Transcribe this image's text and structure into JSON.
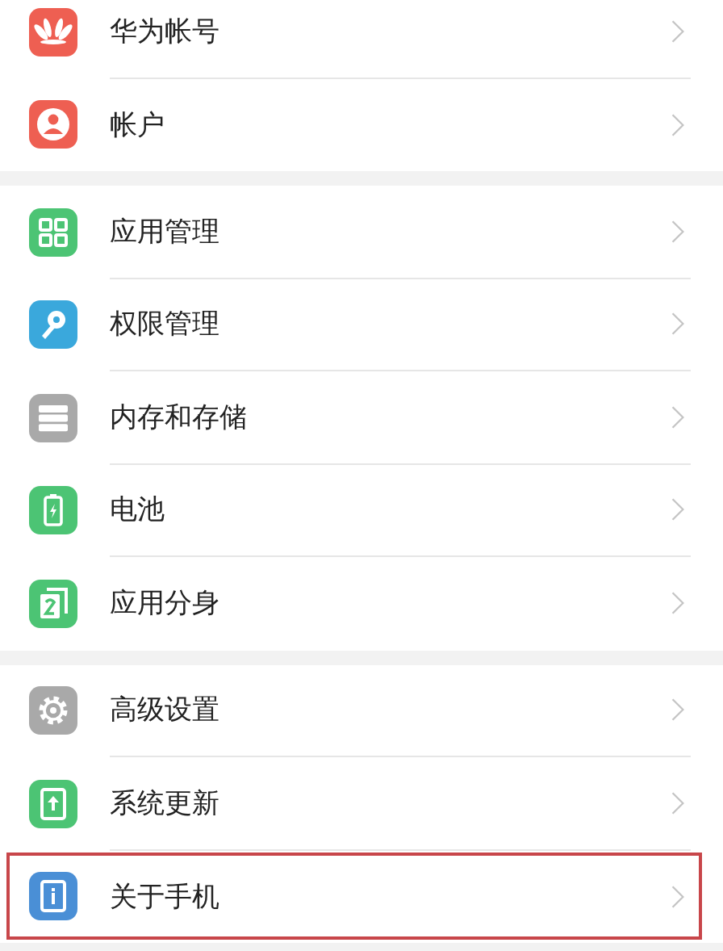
{
  "groups": [
    {
      "items": [
        {
          "label": "华为帐号",
          "kind": "petals",
          "color": "#ee5f52",
          "highlighted": false
        },
        {
          "label": "帐户",
          "kind": "person",
          "color": "#ee5f52",
          "highlighted": false
        }
      ]
    },
    {
      "items": [
        {
          "label": "应用管理",
          "kind": "grid",
          "color": "#4cc474",
          "highlighted": false
        },
        {
          "label": "权限管理",
          "kind": "key",
          "color": "#3aa8dc",
          "highlighted": false
        },
        {
          "label": "内存和存储",
          "kind": "storage",
          "color": "#a9a9a9",
          "highlighted": false
        },
        {
          "label": "电池",
          "kind": "battery",
          "color": "#4cc474",
          "highlighted": false
        },
        {
          "label": "应用分身",
          "kind": "twin",
          "color": "#4cc474",
          "highlighted": false
        }
      ]
    },
    {
      "items": [
        {
          "label": "高级设置",
          "kind": "gear",
          "color": "#a9a9a9",
          "highlighted": false
        },
        {
          "label": "系统更新",
          "kind": "update",
          "color": "#4cc474",
          "highlighted": false
        },
        {
          "label": "关于手机",
          "kind": "info",
          "color": "#4a8fd6",
          "highlighted": true
        }
      ]
    }
  ]
}
